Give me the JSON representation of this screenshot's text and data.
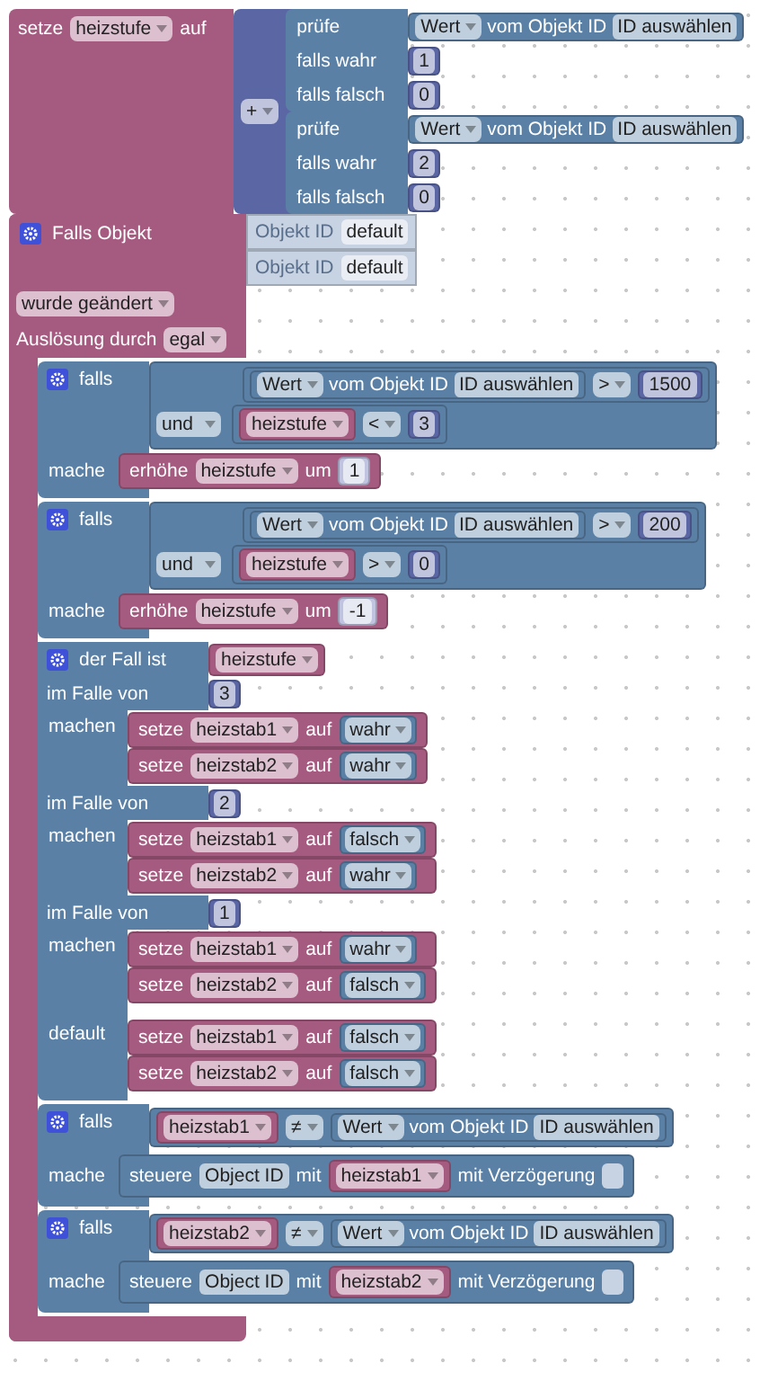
{
  "assign": {
    "label": "setze",
    "variable": "heizstufe",
    "to_label": "auf",
    "operator": "+",
    "ternaries": [
      {
        "check_label": "prüfe",
        "value_dropdown": "Wert",
        "object_label": "vom Objekt ID",
        "object_field": "ID auswählen",
        "true_label": "falls wahr",
        "true_value": "1",
        "false_label": "falls falsch",
        "false_value": "0"
      },
      {
        "check_label": "prüfe",
        "value_dropdown": "Wert",
        "object_label": "vom Objekt ID",
        "object_field": "ID auswählen",
        "true_label": "falls wahr",
        "true_value": "2",
        "false_label": "falls falsch",
        "false_value": "0"
      }
    ]
  },
  "trigger": {
    "title": "Falls Objekt",
    "object_inputs": [
      {
        "label": "Objekt ID",
        "value": "default"
      },
      {
        "label": "Objekt ID",
        "value": "default"
      }
    ],
    "event": "wurde geändert",
    "trigger_label": "Auslösung durch",
    "trigger_value": "egal",
    "statements": [
      {
        "kind": "if_and",
        "label": "falls",
        "first": {
          "value_dropdown": "Wert",
          "object_label": "vom Objekt ID",
          "object_field": "ID auswählen",
          "operator": ">",
          "number": "1500"
        },
        "conjunction": "und",
        "second": {
          "variable": "heizstufe",
          "operator": "<",
          "number": "3"
        },
        "do_label": "mache",
        "action": {
          "label": "erhöhe",
          "variable": "heizstufe",
          "by_label": "um",
          "amount": "1"
        }
      },
      {
        "kind": "if_and",
        "label": "falls",
        "first": {
          "value_dropdown": "Wert",
          "object_label": "vom Objekt ID",
          "object_field": "ID auswählen",
          "operator": ">",
          "number": "200"
        },
        "conjunction": "und",
        "second": {
          "variable": "heizstufe",
          "operator": ">",
          "number": "0"
        },
        "do_label": "mache",
        "action": {
          "label": "erhöhe",
          "variable": "heizstufe",
          "by_label": "um",
          "amount": "-1"
        }
      },
      {
        "kind": "switch",
        "label": "der Fall ist",
        "variable": "heizstufe",
        "cases": [
          {
            "case_label": "im Falle von",
            "value": "3",
            "do_label": "machen",
            "sets": [
              {
                "label": "setze",
                "variable": "heizstab1",
                "to_label": "auf",
                "value": "wahr"
              },
              {
                "label": "setze",
                "variable": "heizstab2",
                "to_label": "auf",
                "value": "wahr"
              }
            ]
          },
          {
            "case_label": "im Falle von",
            "value": "2",
            "do_label": "machen",
            "sets": [
              {
                "label": "setze",
                "variable": "heizstab1",
                "to_label": "auf",
                "value": "falsch"
              },
              {
                "label": "setze",
                "variable": "heizstab2",
                "to_label": "auf",
                "value": "wahr"
              }
            ]
          },
          {
            "case_label": "im Falle von",
            "value": "1",
            "do_label": "machen",
            "sets": [
              {
                "label": "setze",
                "variable": "heizstab1",
                "to_label": "auf",
                "value": "wahr"
              },
              {
                "label": "setze",
                "variable": "heizstab2",
                "to_label": "auf",
                "value": "falsch"
              }
            ]
          }
        ],
        "default": {
          "label": "default",
          "sets": [
            {
              "label": "setze",
              "variable": "heizstab1",
              "to_label": "auf",
              "value": "falsch"
            },
            {
              "label": "setze",
              "variable": "heizstab2",
              "to_label": "auf",
              "value": "falsch"
            }
          ]
        }
      },
      {
        "kind": "if_control",
        "label": "falls",
        "variable": "heizstab1",
        "operator": "≠",
        "value_dropdown": "Wert",
        "object_label": "vom Objekt ID",
        "object_field": "ID auswählen",
        "do_label": "mache",
        "action": {
          "label": "steuere",
          "object": "Object ID",
          "with_label": "mit",
          "variable": "heizstab1",
          "delay_label": "mit Verzögerung",
          "delay_checked": false
        }
      },
      {
        "kind": "if_control",
        "label": "falls",
        "variable": "heizstab2",
        "operator": "≠",
        "value_dropdown": "Wert",
        "object_label": "vom Objekt ID",
        "object_field": "ID auswählen",
        "do_label": "mache",
        "action": {
          "label": "steuere",
          "object": "Object ID",
          "with_label": "mit",
          "variable": "heizstab2",
          "delay_label": "mit Verzögerung",
          "delay_checked": false
        }
      }
    ]
  }
}
